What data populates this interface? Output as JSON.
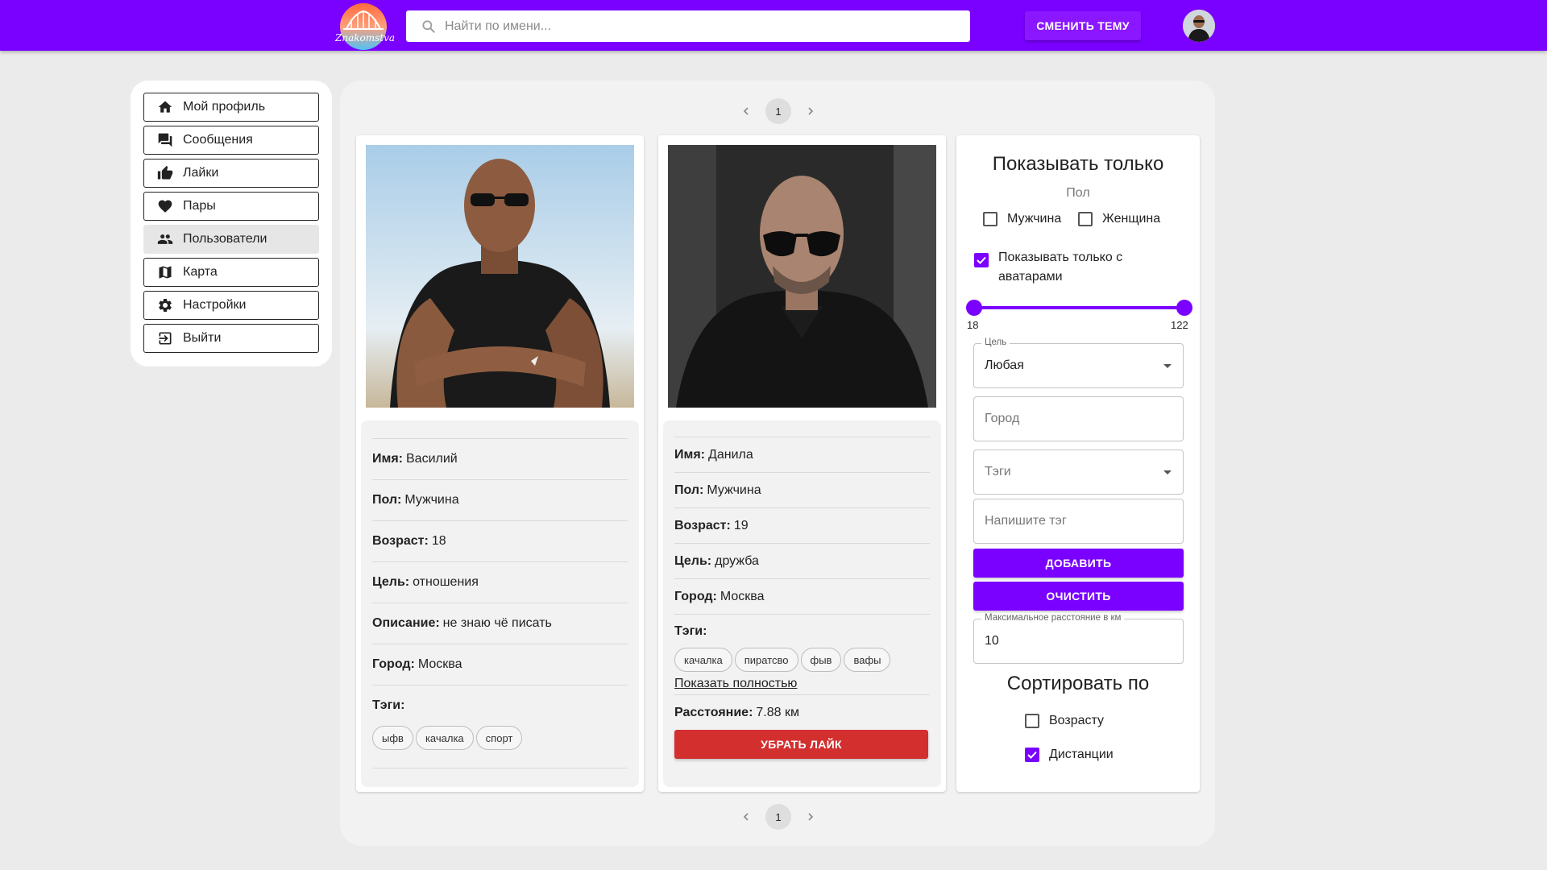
{
  "header": {
    "logo_text": "Znakomstva",
    "search_placeholder": "Найти по имени...",
    "theme_button": "СМЕНИТЬ ТЕМУ"
  },
  "sidebar": {
    "items": [
      {
        "label": "Мой профиль",
        "icon": "home-icon"
      },
      {
        "label": "Сообщения",
        "icon": "chat-icon"
      },
      {
        "label": "Лайки",
        "icon": "thumb-up-icon"
      },
      {
        "label": "Пары",
        "icon": "heart-icon"
      },
      {
        "label": "Пользователи",
        "icon": "people-icon",
        "active": true
      },
      {
        "label": "Карта",
        "icon": "map-icon"
      },
      {
        "label": "Настройки",
        "icon": "gear-icon"
      },
      {
        "label": "Выйти",
        "icon": "logout-icon"
      }
    ]
  },
  "pagination": {
    "current": "1"
  },
  "users": [
    {
      "name_label": "Имя:",
      "name": "Василий",
      "gender_label": "Пол:",
      "gender": "Мужчина",
      "age_label": "Возраст:",
      "age": "18",
      "goal_label": "Цель:",
      "goal": "отношения",
      "desc_label": "Описание:",
      "desc": "не знаю чё писать",
      "city_label": "Город:",
      "city": "Москва",
      "tags_label": "Тэги:",
      "tags": [
        "ыфв",
        "качалка",
        "спорт"
      ]
    },
    {
      "name_label": "Имя:",
      "name": "Данила",
      "gender_label": "Пол:",
      "gender": "Мужчина",
      "age_label": "Возраст:",
      "age": "19",
      "goal_label": "Цель:",
      "goal": "дружба",
      "city_label": "Город:",
      "city": "Москва",
      "tags_label": "Тэги:",
      "tags": [
        "качалка",
        "пиратсво",
        "фыв",
        "вафы"
      ],
      "show_full": "Показать полностью",
      "distance_label": "Расстояние:",
      "distance": "7.88 км",
      "unlike_button": "УБРАТЬ ЛАЙК"
    }
  ],
  "filter": {
    "title": "Показывать только",
    "gender_label": "Пол",
    "male": "Мужчина",
    "female": "Женщина",
    "avatars_only_line1": "Показывать только с",
    "avatars_only_line2": "аватарами",
    "age_min": "18",
    "age_max": "122",
    "goal_legend": "Цель",
    "goal_value": "Любая",
    "city_placeholder": "Город",
    "tags_placeholder": "Тэги",
    "tag_input_placeholder": "Напишите тэг",
    "add_button": "ДОБАВИТЬ",
    "clear_button": "ОЧИСТИТЬ",
    "distance_legend": "Максимальное расстояние в км",
    "distance_value": "10",
    "sort_title": "Сортировать по",
    "sort_age": "Возрасту",
    "sort_distance": "Дистанции"
  },
  "colors": {
    "accent": "#7a00ff",
    "danger": "#d32f2f",
    "background": "#ebebeb"
  }
}
